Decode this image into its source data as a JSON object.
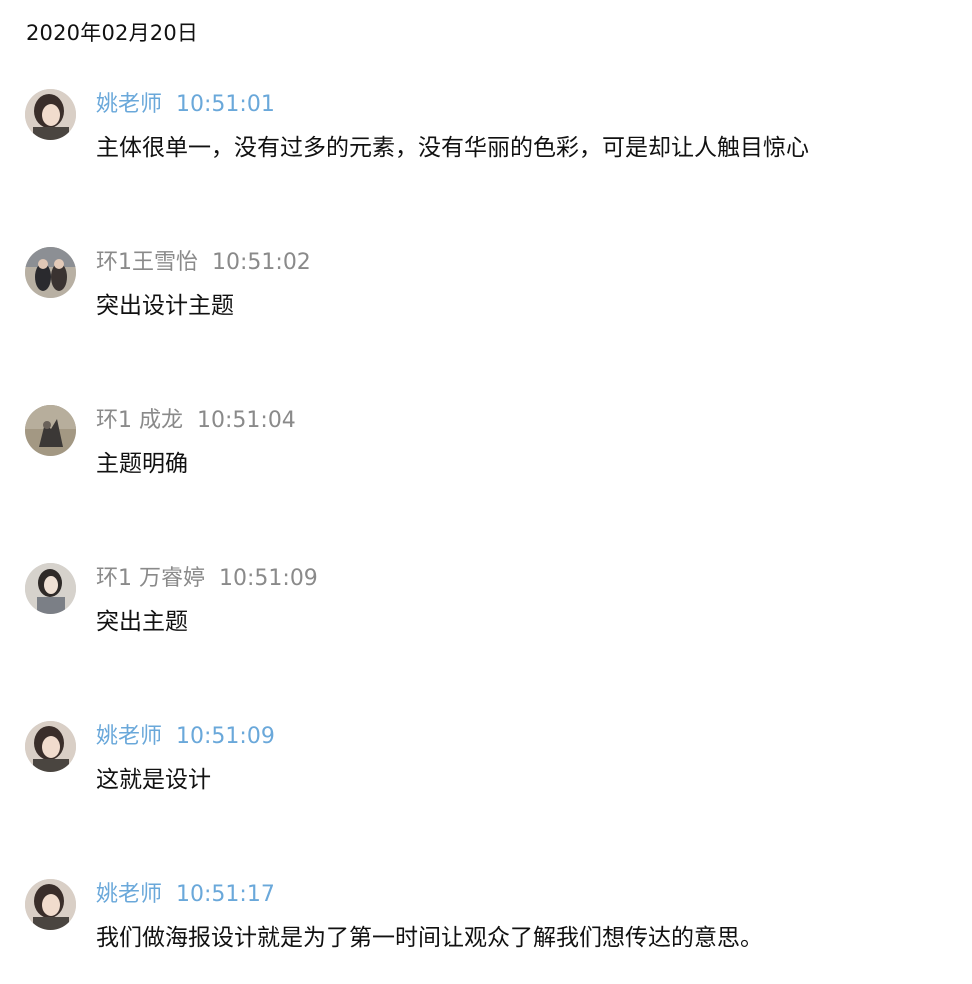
{
  "date_header": "2020年02月20日",
  "messages": [
    {
      "sender": "姚老师",
      "time": "10:51:01",
      "text": "主体很单一，没有过多的元素，没有华丽的色彩，可是却让人触目惊心",
      "role": "teacher"
    },
    {
      "sender": "环1王雪怡",
      "time": "10:51:02",
      "text": "突出设计主题",
      "role": "student"
    },
    {
      "sender": "环1 成龙",
      "time": "10:51:04",
      "text": "主题明确",
      "role": "student"
    },
    {
      "sender": "环1 万睿婷",
      "time": "10:51:09",
      "text": "突出主题",
      "role": "student"
    },
    {
      "sender": "姚老师",
      "time": "10:51:09",
      "text": "这就是设计",
      "role": "teacher"
    },
    {
      "sender": "姚老师",
      "time": "10:51:17",
      "text": "我们做海报设计就是为了第一时间让观众了解我们想传达的意思。",
      "role": "teacher"
    }
  ],
  "colors": {
    "teacher_name": "#6aa8da",
    "student_name": "#8a8a8a",
    "message_text": "#111111",
    "background": "#ffffff"
  }
}
